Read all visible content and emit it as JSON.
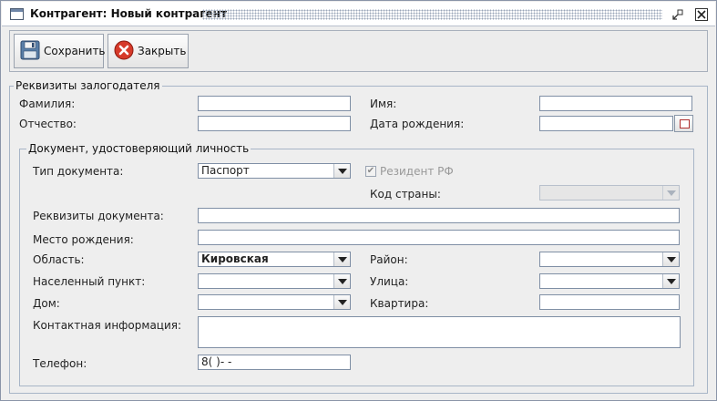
{
  "window": {
    "title": "Контрагент:  Новый контрагент"
  },
  "toolbar": {
    "save_label": "Сохранить",
    "close_label": "Закрыть"
  },
  "pledgor": {
    "legend": "Реквизиты залогодателя",
    "last_name_label": "Фамилия:",
    "last_name_value": "",
    "first_name_label": "Имя:",
    "first_name_value": "",
    "patronymic_label": "Отчество:",
    "patronymic_value": "",
    "birth_date_label": "Дата рождения:",
    "birth_date_value": ""
  },
  "document": {
    "legend": "Документ, удостоверяющий личность",
    "doc_type_label": "Тип документа:",
    "doc_type_value": "Паспорт",
    "resident_label": "Резидент РФ",
    "resident_checked": true,
    "country_code_label": "Код страны:",
    "country_code_value": "",
    "doc_details_label": "Реквизиты документа:",
    "doc_details_value": "",
    "birth_place_label": "Место рождения:",
    "birth_place_value": "",
    "region_label": "Область:",
    "region_value": "Кировская",
    "district_label": "Район:",
    "district_value": "",
    "settlement_label": "Населенный пункт:",
    "settlement_value": "",
    "street_label": "Улица:",
    "street_value": "",
    "house_label": "Дом:",
    "house_value": "",
    "apartment_label": "Квартира:",
    "apartment_value": "",
    "contact_label": "Контактная информация:",
    "contact_value": "",
    "phone_label": "Телефон:",
    "phone_value": "8(  )-   -"
  },
  "icons": {
    "save": "floppy-disk-icon",
    "close": "red-x-circle-icon",
    "calendar": "calendar-icon"
  },
  "colors": {
    "border": "#7f8fa5",
    "group_border": "#a7b5c7",
    "background": "#eeeeee"
  }
}
